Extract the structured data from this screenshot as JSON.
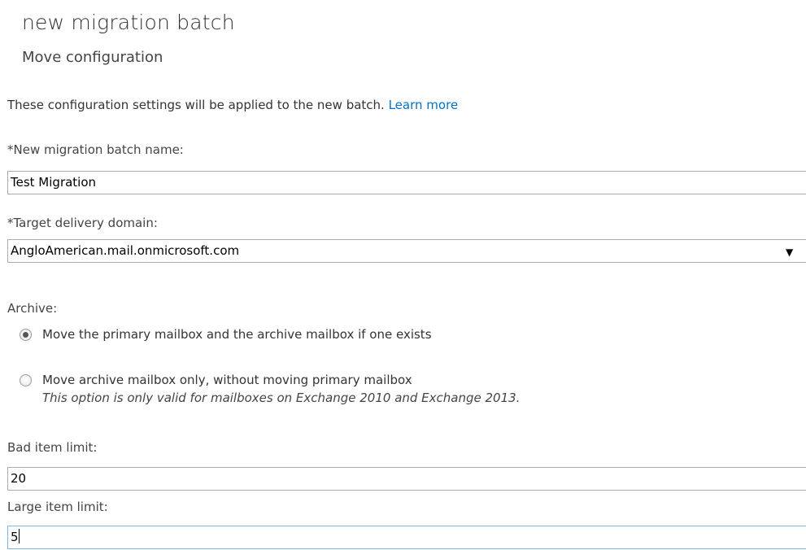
{
  "header": {
    "title": "new migration batch",
    "subtitle": "Move configuration"
  },
  "intro": {
    "text": "These configuration settings will be applied to the new batch.",
    "link": "Learn more"
  },
  "batch_name": {
    "label": "*New migration batch name:",
    "value": "Test Migration"
  },
  "target_domain": {
    "label": "*Target delivery domain:",
    "value": "AngloAmerican.mail.onmicrosoft.com"
  },
  "archive": {
    "label": "Archive:",
    "options": [
      {
        "label": "Move the primary mailbox and the archive mailbox if one exists",
        "selected": true
      },
      {
        "label": "Move archive mailbox only, without moving primary mailbox",
        "selected": false,
        "note": "This option is only valid for mailboxes on Exchange 2010 and Exchange 2013."
      }
    ]
  },
  "bad_item_limit": {
    "label": "Bad item limit:",
    "value": "20"
  },
  "large_item_limit": {
    "label": "Large item limit:",
    "value": "5"
  },
  "icons": {
    "dropdown": "chevron-down-icon"
  },
  "colors": {
    "link": "#0072c6",
    "focus_border": "#7eb4ea"
  }
}
